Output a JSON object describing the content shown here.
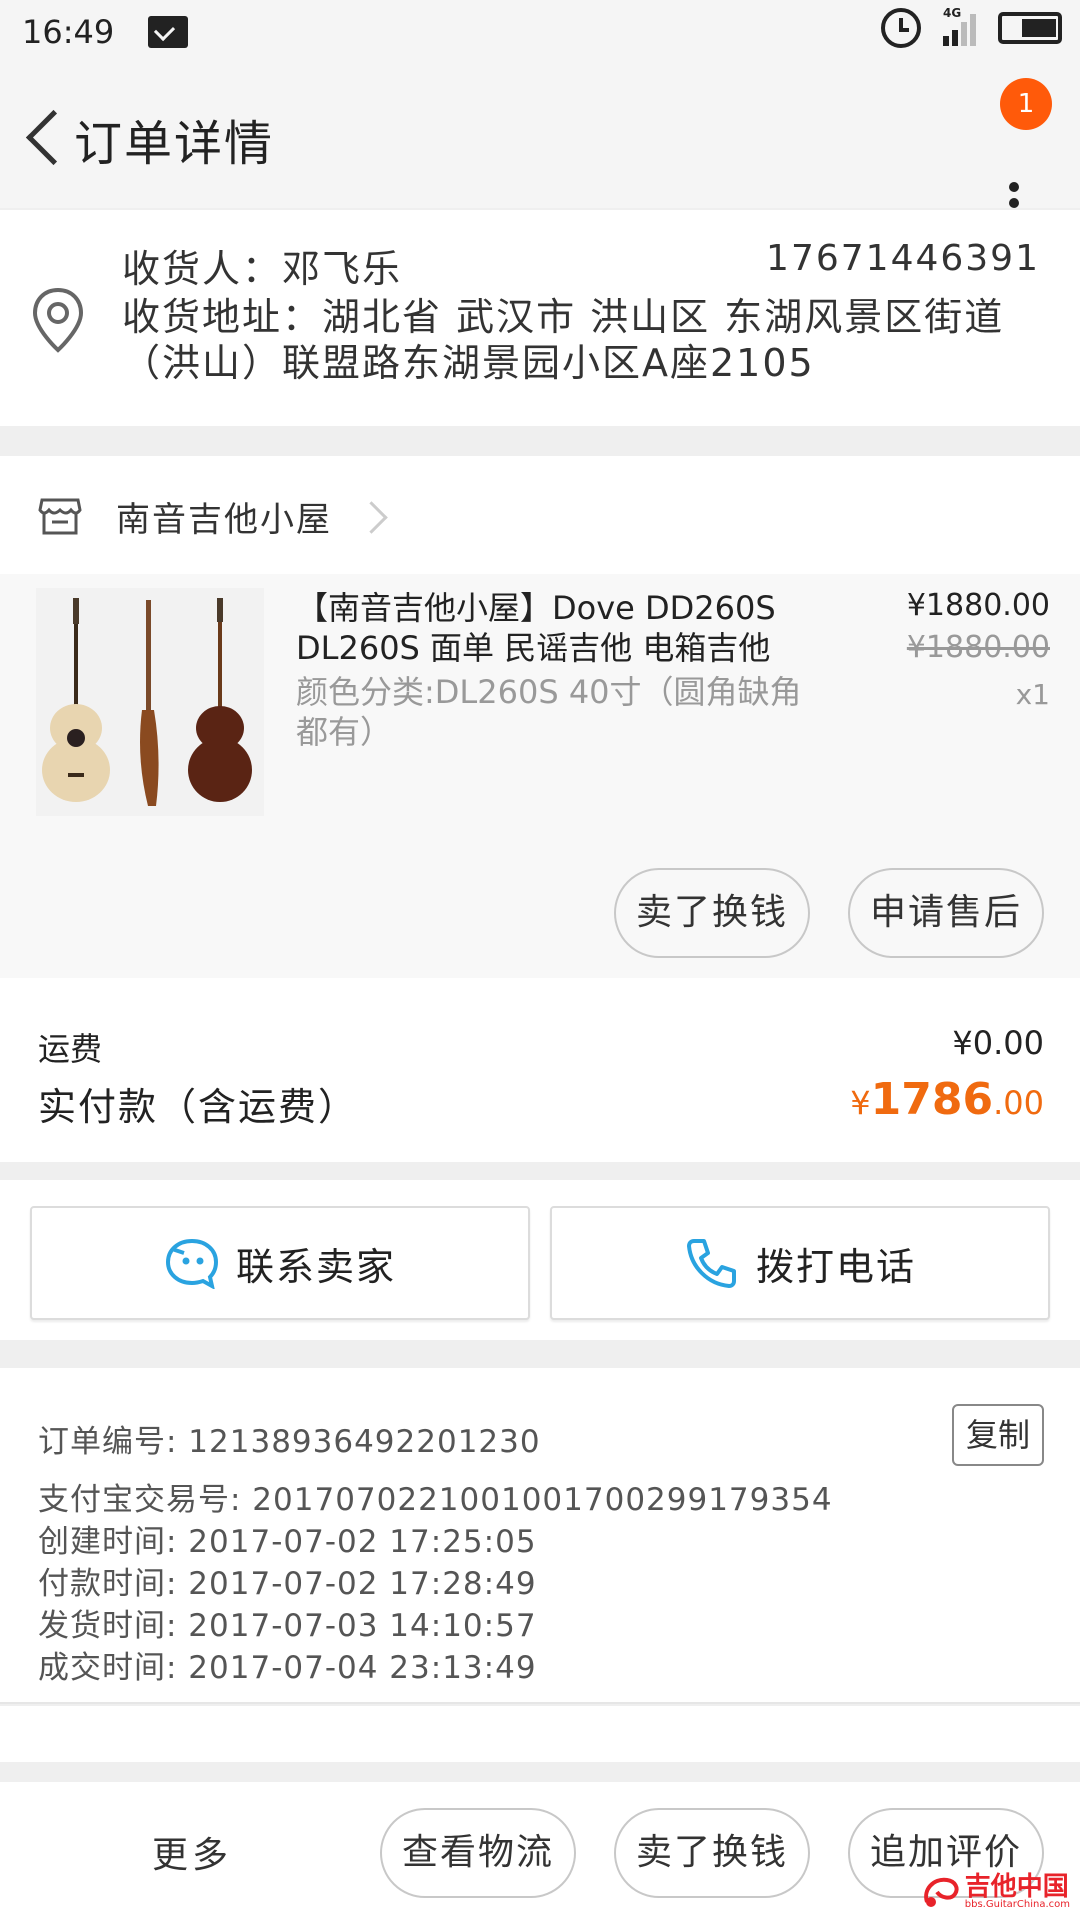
{
  "status_bar": {
    "time": "16:49",
    "network": "4G"
  },
  "header": {
    "title": "订单详情",
    "badge_count": "1"
  },
  "address": {
    "name_line": "收货人：邓飞乐",
    "phone": "17671446391",
    "address_line": "收货地址：湖北省 武汉市 洪山区 东湖风景区街道（洪山）联盟路东湖景园小区A座2105"
  },
  "shop": {
    "name": "南音吉他小屋"
  },
  "product": {
    "title": "【南音吉他小屋】Dove DD260S DL260S 面单 民谣吉他 电箱吉他",
    "sku": "颜色分类:DL260S 40寸（圆角缺角都有）",
    "price": "¥1880.00",
    "original_price": "¥1880.00",
    "quantity": "x1",
    "buttons": {
      "sell": "卖了换钱",
      "after_sale": "申请售后"
    }
  },
  "cost": {
    "shipping_label": "运费",
    "shipping_value": "¥0.00",
    "total_label": "实付款（含运费）",
    "total_currency": "¥",
    "total_integer": "1786",
    "total_decimal": ".00"
  },
  "contact": {
    "seller": "联系卖家",
    "call": "拨打电话"
  },
  "order_info": {
    "order_no": "订单编号: 12138936492201230",
    "copy": "复制",
    "alipay_no": "支付宝交易号: 2017070221001001700299179354",
    "created": "创建时间: 2017-07-02 17:25:05",
    "paid": "付款时间: 2017-07-02 17:28:49",
    "shipped": "发货时间: 2017-07-03 14:10:57",
    "completed": "成交时间: 2017-07-04 23:13:49"
  },
  "bottom_bar": {
    "more": "更多",
    "logistics": "查看物流",
    "sell": "卖了换钱",
    "review": "追加评价"
  },
  "watermark": {
    "title": "吉他中国",
    "url": "bbs.GuitarChina.com"
  },
  "colors": {
    "accent": "#f06a0f",
    "badge": "#ff5a0a",
    "chat_icon": "#2aa3e0"
  }
}
